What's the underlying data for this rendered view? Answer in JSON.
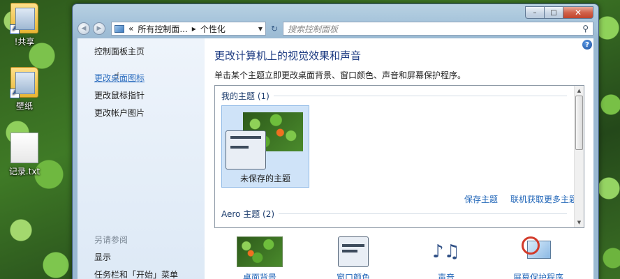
{
  "desktop": {
    "icons": [
      {
        "label": "!共享"
      },
      {
        "label": "壁纸"
      },
      {
        "label": "记录.txt"
      }
    ]
  },
  "window": {
    "buttons": {
      "minimize": "–",
      "maximize": "□",
      "close": "✕"
    },
    "nav": {
      "back": "◀",
      "forward": "▶"
    },
    "address": {
      "part1": "所有控制面...",
      "sep": "▸",
      "part2": "个性化",
      "prefix": "«"
    },
    "search": {
      "placeholder": "搜索控制面板"
    },
    "sidebar": {
      "home": "控制面板主页",
      "links": [
        "更改桌面图标",
        "更改鼠标指针",
        "更改帐户图片"
      ],
      "see_also": "另请参阅",
      "see_also_links": [
        "显示",
        "任务栏和「开始」菜单"
      ]
    },
    "content": {
      "title": "更改计算机上的视觉效果和声音",
      "desc": "单击某个主题立即更改桌面背景、窗口颜色、声音和屏幕保护程序。",
      "my_themes": "我的主题 (1)",
      "unsaved_theme": "未保存的主题",
      "save_theme": "保存主题",
      "get_more": "联机获取更多主题",
      "aero": "Aero 主题 (2)",
      "bottom": [
        "桌面背景",
        "窗口颜色",
        "声音",
        "屏幕保护程序"
      ]
    }
  },
  "colors": {
    "title": "#1d3b82",
    "link": "#2166b8"
  }
}
